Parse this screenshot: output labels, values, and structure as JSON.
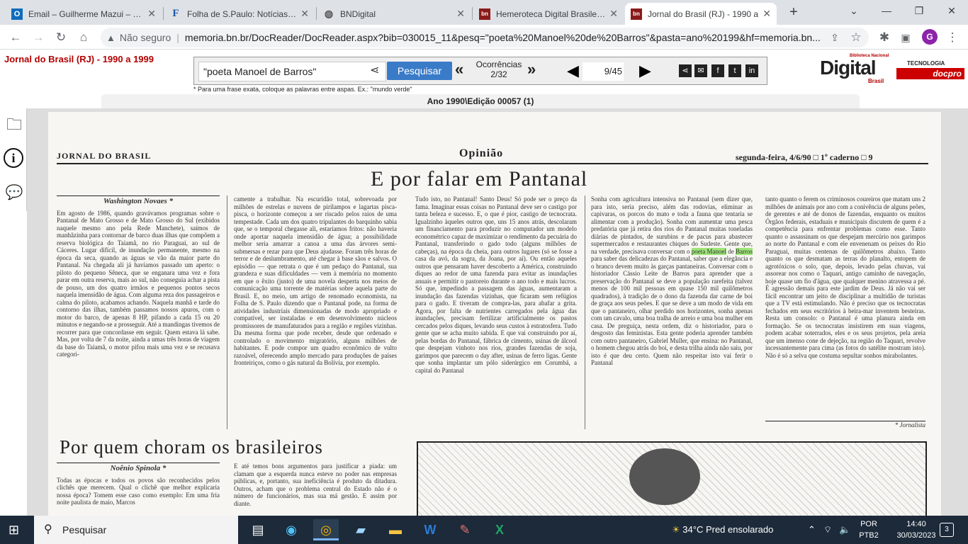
{
  "browser": {
    "tabs": [
      {
        "title": "Email – Guilherme Mazui – Ou",
        "icon": "outlook-icon"
      },
      {
        "title": "Folha de S.Paulo: Notícias, Im",
        "icon": "folha-icon"
      },
      {
        "title": "BNDigital",
        "icon": "globe-icon"
      },
      {
        "title": "Hemeroteca Digital Brasileira",
        "icon": "bn-icon"
      },
      {
        "title": "Jornal do Brasil (RJ) - 1990 a",
        "icon": "bn-icon",
        "active": true
      }
    ],
    "security_label": "Não seguro",
    "url": "memoria.bn.br/DocReader/DocReader.aspx?bib=030015_11&pesq=\"poeta%20Manoel%20de%20Barros\"&pasta=ano%20199&hf=memoria.bn...",
    "profile_initial": "G"
  },
  "reader": {
    "journal_title": "Jornal do Brasil (RJ) - 1990 a 1999",
    "search_value": "\"poeta Manoel de Barros\"",
    "search_button": "Pesquisar",
    "occurrences_label": "Ocorrências",
    "occurrences_value": "2/32",
    "page_value": "9",
    "page_total": "/45",
    "hint": "* Para uma frase exata, coloque as palavras entre aspas. Ex.: \"mundo verde\"",
    "edition": "Ano 1990\\Edição 00057 (1)",
    "logo_text": "Digital",
    "logo_small": "Biblioteca Nacional",
    "logo_country": "Brasil",
    "tech_label": "TECNOLOGIA",
    "docpro_label": "docpro"
  },
  "newspaper": {
    "masthead": "JORNAL DO BRASIL",
    "section": "Opinião",
    "date": "segunda-feira, 4/6/90  □  1º caderno  □  9",
    "headline1": "E por falar em Pantanal",
    "author1": "Washington Novaes *",
    "col1": "Em agosto de 1986, quando gravávamos programas sobre o Pantanal de Mato Grosso e de Mato Grosso do Sul (exibidos naquele mesmo ano pela Rede Manchete), saímos de manhãzinha para contornar de barco duas ilhas que compõem a reserva biológica do Taiamã, no rio Paraguai, ao sul de Cáceres. Lugar difícil, de inundação permanente, mesmo na época da seca, quando as águas se vão da maior parte do Pantanal. Na chegada ali já havíamos passado um aperto: o piloto do pequeno Sêneca, que se enganara uma vez e fora parar em outra reserva, mais ao sul, não conseguia achar a pista de pouso, um dos quatro irmãos e pequenos pontos secos naquela imensidão de água. Com alguma reza dos passageiros e calma do piloto, acabamos achando. Naquela manhã e tarde do contorno das ilhas, também passamos nossos apuros, com o motor do barco, de apenas 8 HP, pifando a cada 15 ou 20 minutos e negando-se a prosseguir. Até a mandingas tivemos de recorrer para que concordasse em seguir. Quem estava lá sabe. Mas, por volta de 7 da noite, ainda a umas três horas de viagem da base do Taiamã, o motor pifou mais uma vez e se recusava categori-",
    "col2": "camente a trabalhar. Na escuridão total, sobrevoada por milhões de estrelas e nuvens de pirilampos e lagartas pisca-pisca, o horizonte começou a ser riscado pelos raios de uma tempestade. Cada um dos quatro tripulantes do barquinho sabia que, se o temporal chegasse ali, estaríamos fritos: não haveria onde aportar naquela imensidão de água; a possibilidade melhor seria amarrar a canoa a uma das árvores semi-submersas e rezar para que Deus ajudasse. Foram três horas de terror e de deslumbramento, até chegar à base sãos e salvos. O episódio — que retrata o que é um pedaço do Pantanal, sua grandeza e suas dificuldades — vem à memória no momento em que o êxito (justo) de uma novela desperta nos meios de comunicação uma torrente de matérias sobre aquela parte do Brasil. E, no meio, um artigo de renomado economista, na Folha de S. Paulo dizendo que o Pantanal pode, na forma de atividades industriais dimensionadas de modo apropriado e compatível, ser instaladas e em desenvolvimento núcleos promissores de manufaturados para a região e regiões vizinhas. Da mesma forma que pode receber, desde que ordenado e controlado o movimento migratório, alguns milhões de habitantes. E pode compor um quadro econômico de vulto razoável, oferecendo amplo mercado para produções de países fronteiriços, como o gás natural da Bolívia, por exemplo.",
    "col3": "Tudo isto, no Pantanal! Santo Deus! Só pode ser o preço da fama. Imaginar essas coisas no Pantanal deve ser o castigo por tanta beleza e sucesso. E, o que é pior, castigo de tecnocrata. Igualzinho àqueles outros que, uns 15 anos atrás, descolaram um financiamento para produzir no computador um modelo econométrico capaz de maximizar o rendimento da pecuária do Pantanal, transferindo o gado todo (alguns milhões de cabeças), na época da cheia, para outros lugares (só se fosse a casa da avó, da sogra, da Joana, por aí). Ou então aqueles outros que pensaram haver descoberto a América, construindo diques ao redor de uma fazenda para evitar as inundações anuais e permitir o pastoreio durante o ano todo e mais lucros. Só que, impedindo a passagem das águas, aumentaram a inundação das fazendas vizinhas, que ficaram sem refúgios para o gado. E tiveram de compra-las, para abafar a grita. Agora, por falta de nutrientes carregados pela água das inundações, precisam fertilizar artificialmente os pastos cercados pelos diques, levando seus custos à estratosfera. Tudo gente que se acha muito sabida. E que vai construindo por aí, pelas bordas do Pantanal, fábrica de cimento, usinas de álcool que despejam vinhoto nos rios, grandes fazendas de soja, garimpos que parecem o day after, usinas de ferro ligas. Gente que sonha implantar um pólo siderúrgico em Corumbá, a capital do Pantanal",
    "col4_before": "Sonha com agricultura intensiva no Pantanal (sem dizer que, para isto, seria preciso, além das rodovias, eliminar as capivaras, os porcos do mato e toda a fauna que tentaria se alimentar com a produção). Sonha com aumentar uma pesca predatória que já retira dos rios do Pantanal muitas toneladas diárias de pintados, de surubins e de pacus para abastecer supermercados e restaurantes chiques do Sudeste. Gente que, na verdade, precisava conversar com o",
    "col4_hl1": "poeta Manoel",
    "col4_mid": "de",
    "col4_hl2": "Barros",
    "col4_after": "para saber das delicadezas do Pantanal, saber que a elegância e o branco devem muito às garças pantaneiras. Conversar com o historiador Cássio Leite de Barros para aprender que a preservação do Pantanal se deve a população rarefeita (talvez menos de 100 mil pessoas em quase 150 mil quilômetros quadrados), à tradição de o dono da fazenda dar carne de boi de graça aos seus peões. E que se deve a um modo de vida em que o pantaneiro, olhar perdido nos horizontes, sonha apenas com um cavalo, uma boa tralha de arreio e uma boa mulher em casa. De preguiça, nesta ordem, diz o historiador, para o desgosto das feministas. Esta gente poderia aprender também com outro pantaneiro, Gabriel Muller, que ensina: no Pantanal, o homem chegou atrás do boi, e desta trilha ainda não saiu, por isto é que deu certo. Quem não respeitar isto vai ferir o Pantanal",
    "col5": "tanto quanto o ferem os criminosos coureiros que matam uns 2 milhões de animais por ano com a conivência de alguns peões, de gerentes e até de donos de fazendas, enquanto os muitos Órgãos federais, estaduais e municipais discutem de quem é a competência para enfrentar problemas como esse. Tanto quanto o assassinam os que despejam mercúrio nos garimpos ao norte do Pantanal e com ele envenenam os peixes do Rio Paraguai, muitas centenas de quilômetros abaixo. Tanto quanto os que desmatam as terras do planalto, entopem de agrotóxicos o solo, que, depois, levado pelas chuvas, vai assorear nos como o Taquari, antigo caminho de navegação, hoje quase um fio d'água, que qualquer menino atravessa a pé. É agressão demais para este jardim de Deus. Já não vai ser fácil encontrar um jeito de disciplinar a multidão de turistas que a TV está estimulando. Não é preciso que os tecnocratas fechados em seus escritórios à beira-mar inventem besteiras. Resta um consolo: o Pantanal é uma planura ainda em formação. Se os tecnocratas insistirem em suas viagens, podem acabar soterrados, eles e os seus projetos, pela areia que um imenso cone de dejeção, na região do Taquari, revolve incessantemente para cima (as fotos do satélite mostram isto). Não é só a selva que costuma sepultar sonhos mirabolantes.",
    "col5_sig": "* Jornalista",
    "headline2": "Por quem choram os brasileiros",
    "author2": "Noênio Spinola *",
    "col6": "Todas as épocas e todos os povos são reconhecidos pelos clichês que merecem. Qual o clichê que melhor explicaria nossa época? Tomem esse caso como exemplo: Em uma fria noite paulista de maio, Marcos",
    "col7": "E até temos bons argumentos para justificar a piada: um clamam que a esquerda nunca esteve no poder nas empresas públicas, e, portanto, sua ineficiência é produto da ditadura. Outros, acham que o problema central do Estado não é o número de funcionários, mas sua má gestão. E assim por diante."
  },
  "taskbar": {
    "search_placeholder": "Pesquisar",
    "weather": "34°C  Pred ensolarado",
    "lang_line1": "POR",
    "lang_line2": "PTB2",
    "time": "14:40",
    "date": "30/03/2023",
    "notifications": "3"
  }
}
